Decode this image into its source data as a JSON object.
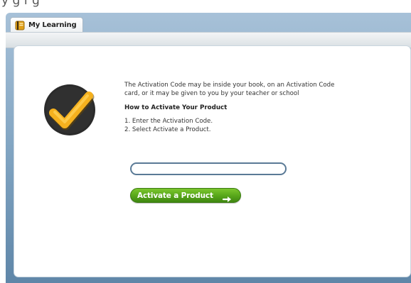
{
  "page_header": {
    "text": "y g f g"
  },
  "tab": {
    "label": "My Learning",
    "icon": "notebook-icon"
  },
  "content": {
    "info_line_1": "The Activation Code may be inside your book, on an Activation Code",
    "info_line_2": "card, or it may be given to you by your teacher or school",
    "heading": "How to Activate Your Product",
    "steps": [
      "1. Enter the Activation Code.",
      "2. Select Activate a Product."
    ],
    "code_input": {
      "value": "",
      "placeholder": ""
    },
    "activate_button": {
      "label": "Activate a Product",
      "icon": "arrow-right-icon"
    }
  },
  "colors": {
    "accent_green": "#59a81b",
    "checkmark_yellow": "#f5b11e",
    "badge_dark": "#2b2b2b",
    "frame_blue": "#7ea2c0"
  }
}
